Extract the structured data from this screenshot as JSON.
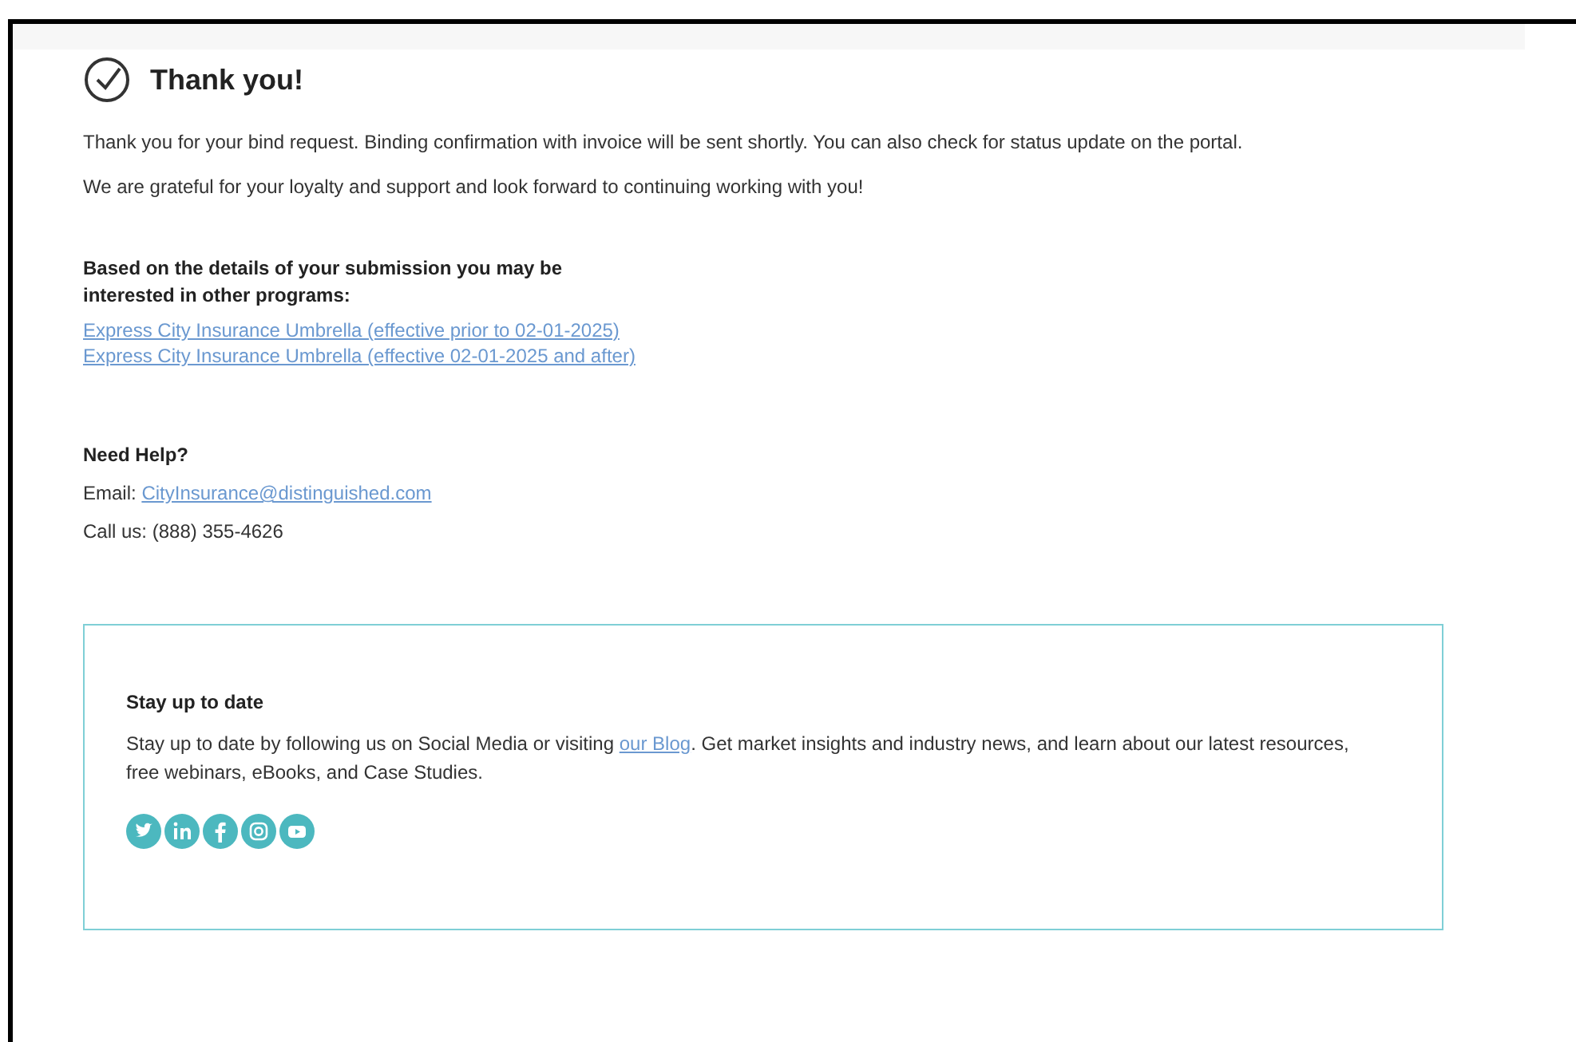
{
  "title": "Thank you!",
  "messages": [
    "Thank you for your bind request. Binding confirmation with invoice will be sent shortly. You can also check for status update on the portal.",
    "We are grateful for your loyalty and support and look forward to continuing working with you!"
  ],
  "programs": {
    "heading": "Based on the details of your submission you may be interested in other programs:",
    "links": [
      "Express City Insurance Umbrella (effective prior to 02-01-2025)",
      "Express City Insurance Umbrella (effective 02-01-2025 and after)"
    ]
  },
  "help": {
    "heading": "Need Help?",
    "email_label": "Email:",
    "email": "CityInsurance@distinguished.com",
    "phone": "Call us: (888) 355-4626"
  },
  "newsletter": {
    "heading": "Stay up to date",
    "text_before": "Stay up to date by following us on Social Media or visiting",
    "link": "our Blog",
    "text_after": ". Get market insights and industry news, and learn about our latest resources, free webinars, eBooks, and Case Studies."
  }
}
